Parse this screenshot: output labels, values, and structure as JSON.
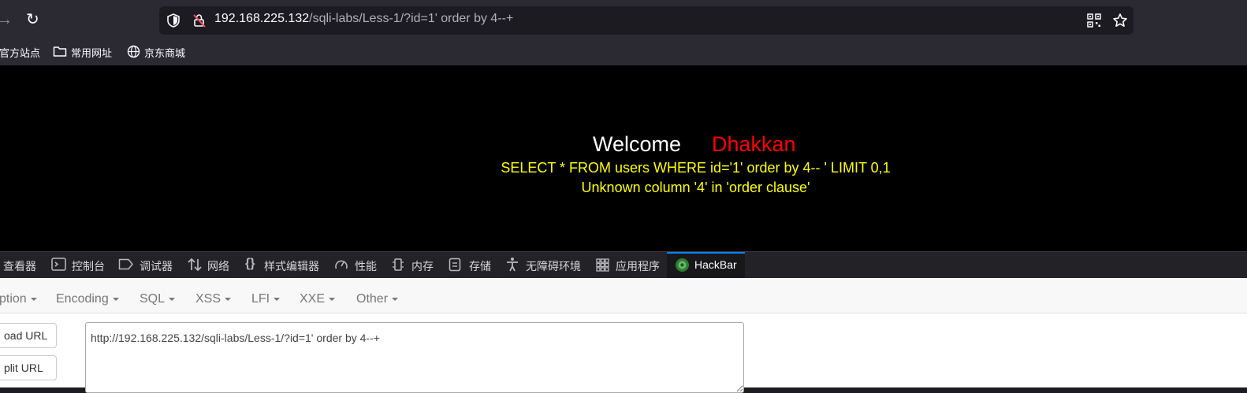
{
  "browser": {
    "nav": {
      "forward_glyph": "→",
      "reload_glyph": "↻"
    },
    "url": {
      "host": "192.168.225.132",
      "path": "/sqli-labs/Less-1/?id=1' order by 4--+"
    },
    "bookmarks": [
      {
        "label": "官方站点",
        "icon": ""
      },
      {
        "label": "常用网址",
        "icon": "folder-icon"
      },
      {
        "label": "京东商城",
        "icon": "globe-icon"
      }
    ]
  },
  "page": {
    "welcome": "Welcome",
    "name": "Dhakkan",
    "sql": "SELECT * FROM users WHERE id='1' order by 4-- ' LIMIT 0,1",
    "error": "Unknown column '4' in 'order clause'"
  },
  "devtools": {
    "tabs": [
      {
        "label": "查看器",
        "icon": "inspector-icon"
      },
      {
        "label": "控制台",
        "icon": "console-icon"
      },
      {
        "label": "调试器",
        "icon": "debugger-icon"
      },
      {
        "label": "网络",
        "icon": "network-icon"
      },
      {
        "label": "样式编辑器",
        "icon": "style-editor-icon"
      },
      {
        "label": "性能",
        "icon": "performance-icon"
      },
      {
        "label": "内存",
        "icon": "memory-icon"
      },
      {
        "label": "存储",
        "icon": "storage-icon"
      },
      {
        "label": "无障碍环境",
        "icon": "accessibility-icon"
      },
      {
        "label": "应用程序",
        "icon": "application-icon"
      },
      {
        "label": "HackBar",
        "icon": "hackbar-icon"
      }
    ],
    "active_tab": "HackBar"
  },
  "hackbar": {
    "menus": [
      "ption",
      "Encoding",
      "SQL",
      "XSS",
      "LFI",
      "XXE",
      "Other"
    ],
    "load_button": "oad URL",
    "split_button": "plit URL",
    "url_value": "http://192.168.225.132/sqli-labs/Less-1/?id=1' order by 4--+"
  },
  "colors": {
    "welcome": "#ffffff",
    "name": "#ff0000",
    "sql_text": "#ffff00",
    "accent": "#0a84ff"
  }
}
